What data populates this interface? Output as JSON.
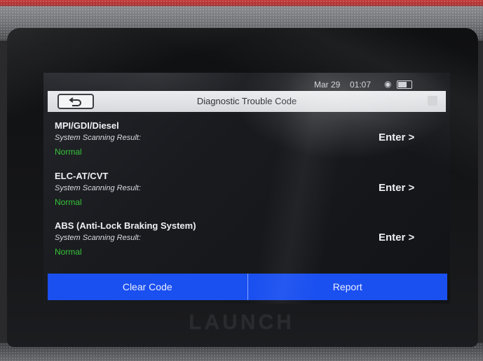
{
  "statusbar": {
    "date": "Mar 29",
    "time": "01:07"
  },
  "header": {
    "title": "Diagnostic Trouble Code"
  },
  "systems": [
    {
      "name": "MPI/GDI/Diesel",
      "result_label": "System Scanning Result:",
      "status": "Normal",
      "action": "Enter >"
    },
    {
      "name": "ELC-AT/CVT",
      "result_label": "System Scanning Result:",
      "status": "Normal",
      "action": "Enter >"
    },
    {
      "name": "ABS (Anti-Lock Braking System)",
      "result_label": "System Scanning Result:",
      "status": "Normal",
      "action": "Enter >"
    }
  ],
  "footer": {
    "clear_label": "Clear Code",
    "report_label": "Report"
  },
  "device": {
    "brand": "LAUNCH"
  },
  "colors": {
    "accent": "#1a4ff0",
    "status_ok": "#38c23a"
  }
}
